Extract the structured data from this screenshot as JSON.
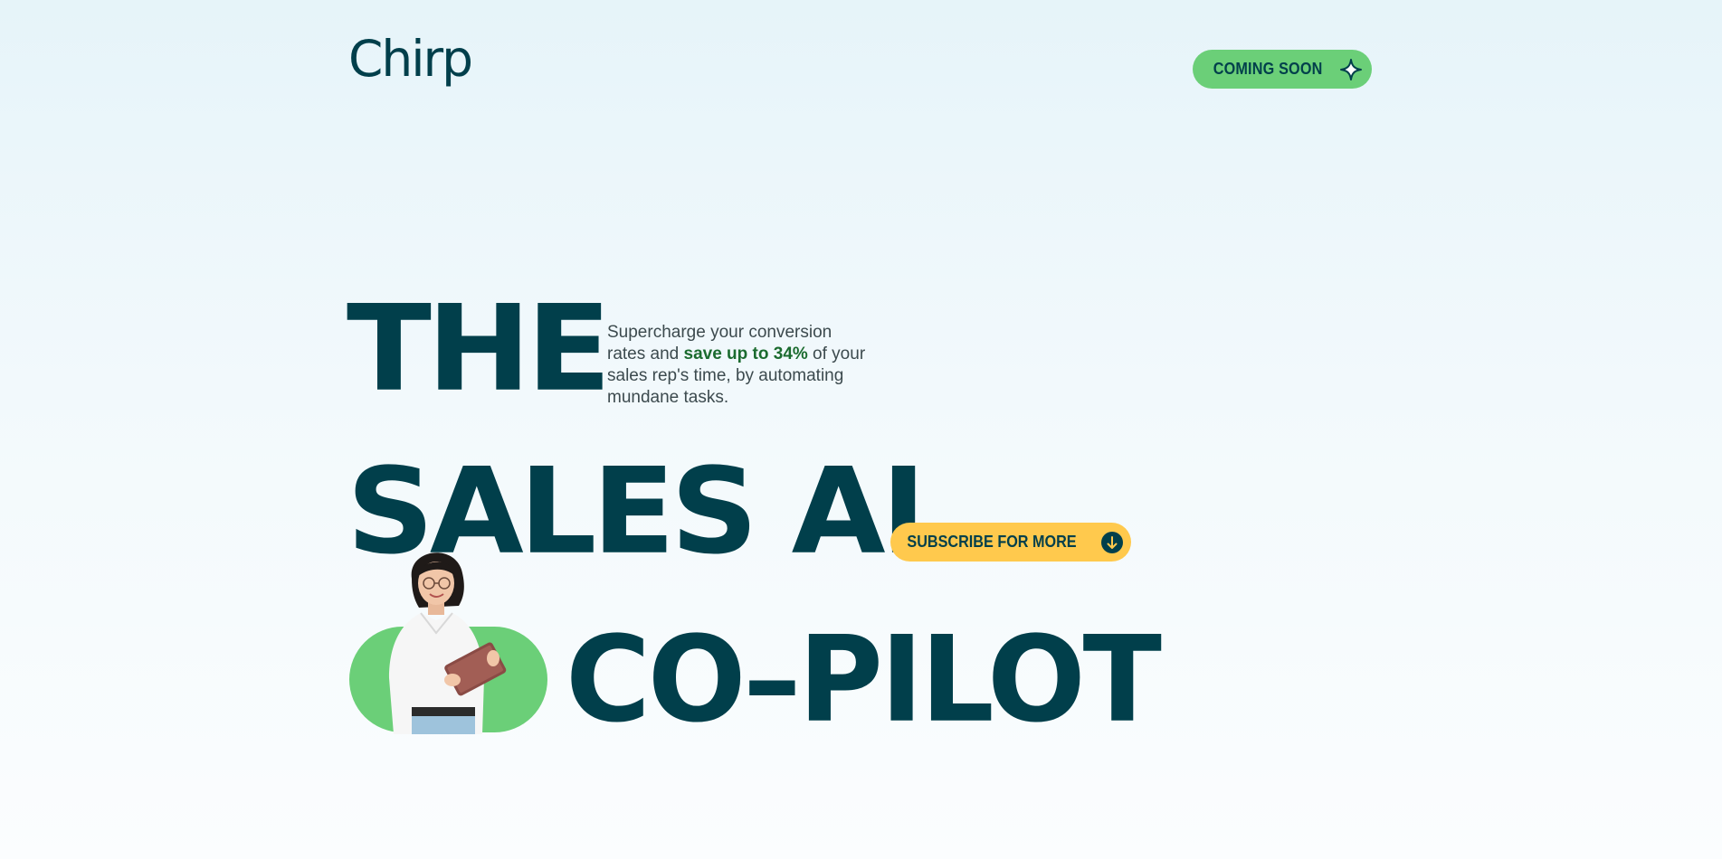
{
  "header": {
    "logo_text": "Chirp",
    "coming_soon_label": "COMING SOON",
    "coming_soon_icon": "sparkle-icon"
  },
  "hero": {
    "line1": "THE",
    "line2": "SALES AI",
    "line3": "CO–PILOT",
    "description_before": "Supercharge your conversion rates and ",
    "description_highlight": "save up to 34%",
    "description_after": " of your sales rep's time, by automating mundane tasks.",
    "subscribe_label": "SUBSCRIBE FOR MORE",
    "subscribe_icon": "arrow-down-circle-icon"
  },
  "colors": {
    "primary": "#013f4b",
    "green": "#6bcf78",
    "yellow": "#ffc94d",
    "highlight": "#1b6b2f"
  }
}
